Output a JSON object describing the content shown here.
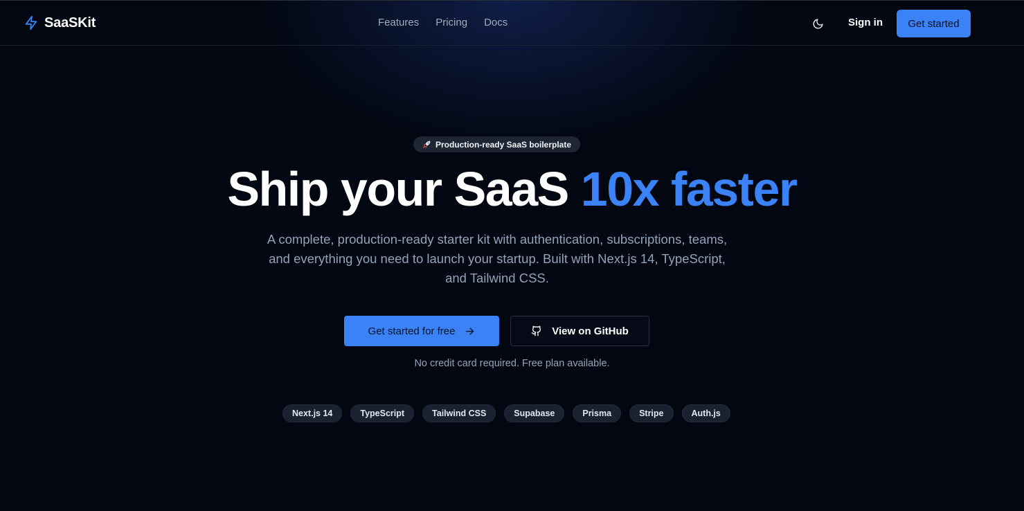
{
  "header": {
    "brand": "SaaSKit",
    "nav": [
      "Features",
      "Pricing",
      "Docs"
    ],
    "sign_in": "Sign in",
    "cta": "Get started"
  },
  "hero": {
    "badge": "Production-ready SaaS boilerplate",
    "headline_plain": "Ship your SaaS ",
    "headline_accent": "10x faster",
    "subtitle": "A complete, production-ready starter kit with authentication, subscriptions, teams, and everything you need to launch your startup. Built with Next.js 14, TypeScript, and Tailwind CSS.",
    "primary_button": "Get started for free",
    "secondary_button": "View on GitHub",
    "note": "No credit card required. Free plan available.",
    "tech": [
      "Next.js 14",
      "TypeScript",
      "Tailwind CSS",
      "Supabase",
      "Prisma",
      "Stripe",
      "Auth.js"
    ]
  },
  "icons": {
    "brand": "lightning-icon",
    "theme": "moon-icon",
    "badge": "rocket-icon",
    "primary_button": "arrow-right-icon",
    "secondary_button": "github-icon"
  },
  "colors": {
    "accent": "#3b82f6",
    "background": "#030712"
  }
}
